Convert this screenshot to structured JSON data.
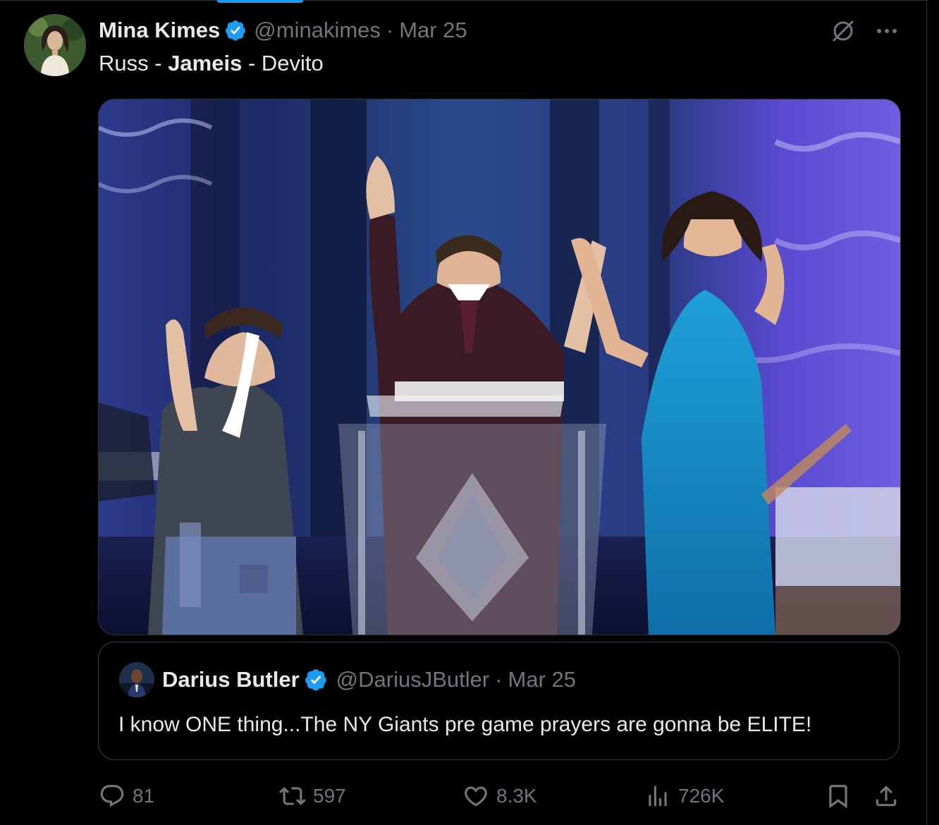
{
  "tweet": {
    "author": {
      "display_name": "Mina Kimes",
      "handle": "@minakimes",
      "verified": true
    },
    "separator": "·",
    "date": "Mar 25",
    "text": {
      "part1": "Russ - ",
      "part2_bold": "Jameis",
      "part3": " - Devito"
    },
    "media_icon": "photo",
    "header_icons": [
      "grok-icon",
      "more-icon"
    ]
  },
  "quote": {
    "author": {
      "display_name": "Darius Butler",
      "handle": "@DariusJButler",
      "verified": true
    },
    "separator": "·",
    "date": "Mar 25",
    "text": "I know ONE thing...The NY Giants pre game prayers are gonna be ELITE!"
  },
  "actions": {
    "replies": "81",
    "reposts": "597",
    "likes": "8.3K",
    "views": "726K"
  },
  "colors": {
    "background": "#000000",
    "text_primary": "#e7e9ea",
    "text_secondary": "#71767b",
    "verified": "#1d9bf0",
    "border": "#2f3336"
  }
}
